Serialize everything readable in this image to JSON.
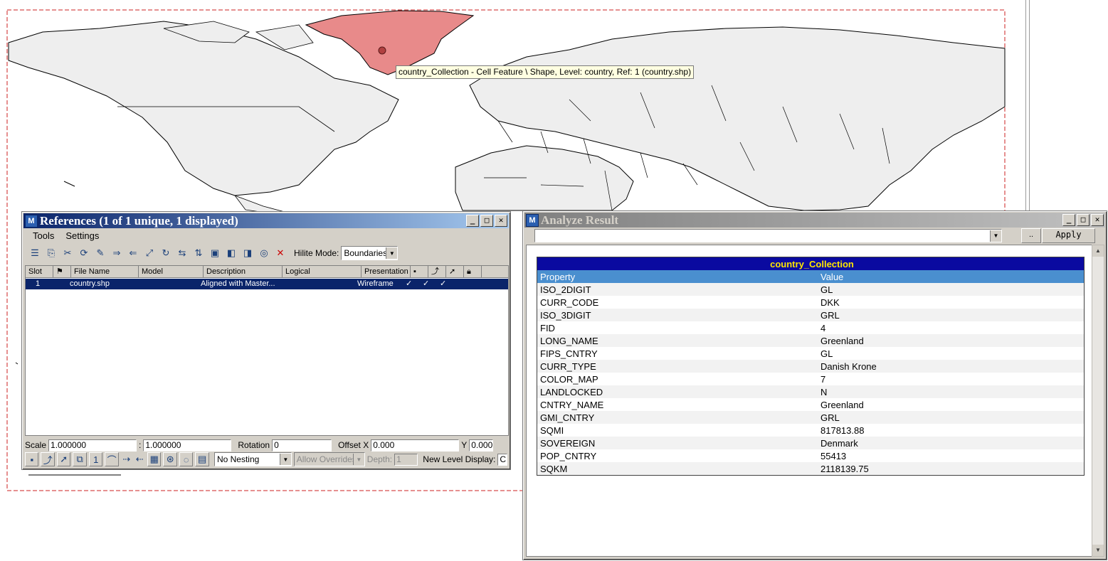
{
  "map": {
    "tooltip": "country_Collection - Cell Feature \\ Shape, Level: country, Ref: 1 (country.shp)",
    "highlight_color": "#e88a8a",
    "land_color": "#eeeeee",
    "border_color": "#cc2222"
  },
  "references": {
    "title": "References (1 of 1 unique, 1 displayed)",
    "menu": [
      "Tools",
      "Settings"
    ],
    "hilite_label": "Hilite Mode:",
    "hilite_value": "Boundaries",
    "columns": [
      "Slot",
      "",
      "File Name",
      "Model",
      "Description",
      "Logical",
      "Presentation",
      "",
      "",
      "",
      ""
    ],
    "rows": [
      {
        "slot": "1",
        "file": "country.shp",
        "model": "",
        "description": "Aligned with Master...",
        "logical": "",
        "presentation": "Wireframe",
        "c1": "✓",
        "c2": "✓",
        "c3": "✓"
      }
    ],
    "scale_label": "Scale",
    "scale_a": "1.000000",
    "scale_sep": ":",
    "scale_b": "1.000000",
    "rotation_label": "Rotation",
    "rotation": "0",
    "offset_x_label": "Offset X",
    "offset_x": "0.000",
    "y_label": "Y",
    "offset_y": "0.000",
    "nesting": "No Nesting",
    "overrides": "Allow Overrides",
    "depth_label": "Depth:",
    "depth": "1",
    "new_level_label": "New Level Display:",
    "new_level_value": "C"
  },
  "analyze": {
    "title": "Analyze Result",
    "combo_value": "",
    "dots": "..",
    "apply": "Apply",
    "table_title": "country_Collection",
    "col_property": "Property",
    "col_value": "Value",
    "rows": [
      {
        "p": "ISO_2DIGIT",
        "v": "GL"
      },
      {
        "p": "CURR_CODE",
        "v": "DKK"
      },
      {
        "p": "ISO_3DIGIT",
        "v": "GRL"
      },
      {
        "p": "FID",
        "v": "4"
      },
      {
        "p": "LONG_NAME",
        "v": "Greenland"
      },
      {
        "p": "FIPS_CNTRY",
        "v": "GL"
      },
      {
        "p": "CURR_TYPE",
        "v": "Danish Krone"
      },
      {
        "p": "COLOR_MAP",
        "v": "7"
      },
      {
        "p": "LANDLOCKED",
        "v": "N"
      },
      {
        "p": "CNTRY_NAME",
        "v": "Greenland"
      },
      {
        "p": "GMI_CNTRY",
        "v": "GRL"
      },
      {
        "p": "SQMI",
        "v": "817813.88"
      },
      {
        "p": "SOVEREIGN",
        "v": "Denmark"
      },
      {
        "p": "POP_CNTRY",
        "v": "55413"
      },
      {
        "p": "SQKM",
        "v": "2118139.75"
      }
    ]
  }
}
